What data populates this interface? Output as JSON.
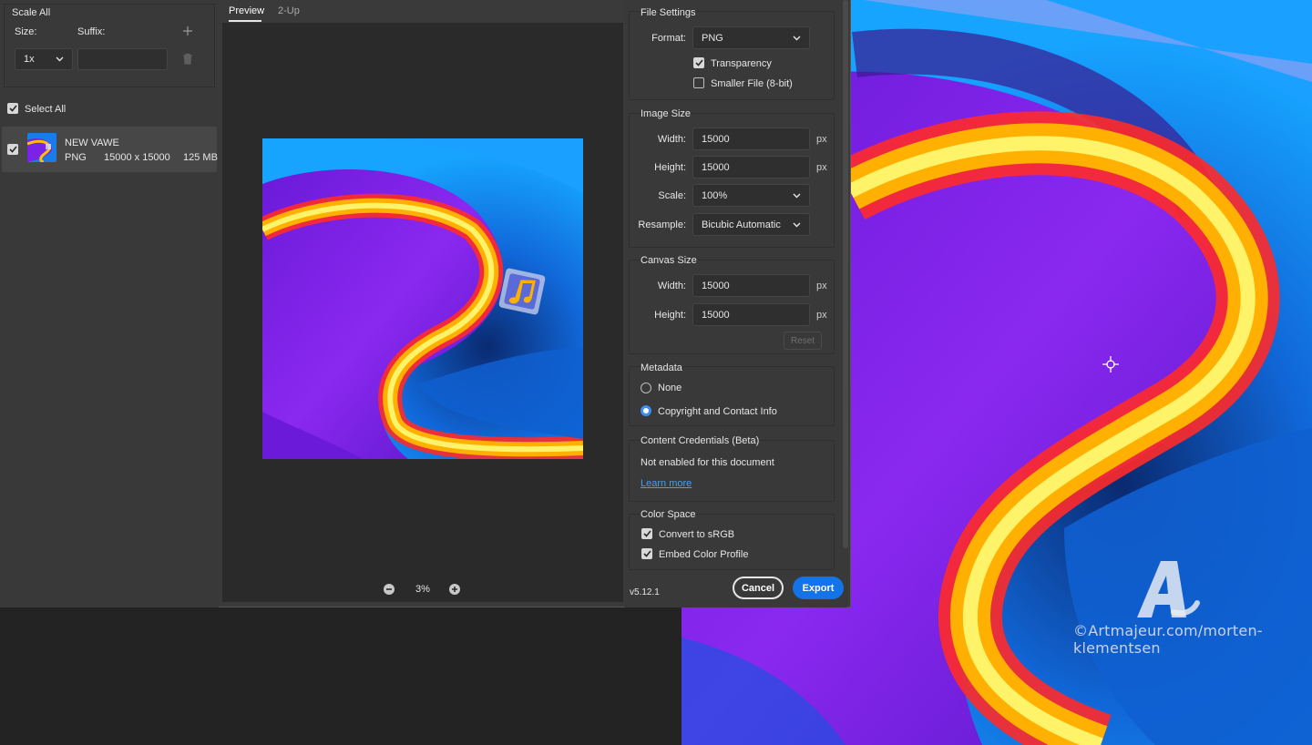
{
  "scale": {
    "title": "Scale All",
    "size_label": "Size:",
    "suffix_label": "Suffix:",
    "size_value": "1x",
    "suffix_value": ""
  },
  "assets": {
    "select_all_label": "Select All",
    "items": [
      {
        "name": "NEW VAWE",
        "format": "PNG",
        "dimensions": "15000 x 15000",
        "size": "125 MB"
      }
    ]
  },
  "preview": {
    "tabs": [
      "Preview",
      "2-Up"
    ],
    "zoom": "3%"
  },
  "file_settings": {
    "title": "File Settings",
    "format_label": "Format:",
    "format_value": "PNG",
    "transparency_label": "Transparency",
    "smaller_file_label": "Smaller File (8-bit)"
  },
  "image_size": {
    "title": "Image Size",
    "width_label": "Width:",
    "width_value": "15000",
    "height_label": "Height:",
    "height_value": "15000",
    "unit": "px",
    "scale_label": "Scale:",
    "scale_value": "100%",
    "resample_label": "Resample:",
    "resample_value": "Bicubic Automatic"
  },
  "canvas_size": {
    "title": "Canvas Size",
    "width_label": "Width:",
    "width_value": "15000",
    "height_label": "Height:",
    "height_value": "15000",
    "unit": "px",
    "reset_label": "Reset"
  },
  "metadata": {
    "title": "Metadata",
    "none_label": "None",
    "copyright_label": "Copyright and Contact Info"
  },
  "content_credentials": {
    "title": "Content Credentials (Beta)",
    "status": "Not enabled for this document",
    "learn_more": "Learn more"
  },
  "color_space": {
    "title": "Color Space",
    "convert_label": "Convert to sRGB",
    "embed_label": "Embed Color Profile"
  },
  "footer": {
    "version": "v5.12.1",
    "cancel_label": "Cancel",
    "export_label": "Export"
  },
  "watermark": {
    "text": "©Artmajeur.com/morten-klementsen"
  },
  "colors": {
    "accent": "#1473e6",
    "radio_on": "#3d8ef0",
    "link": "#4d9cf5"
  }
}
